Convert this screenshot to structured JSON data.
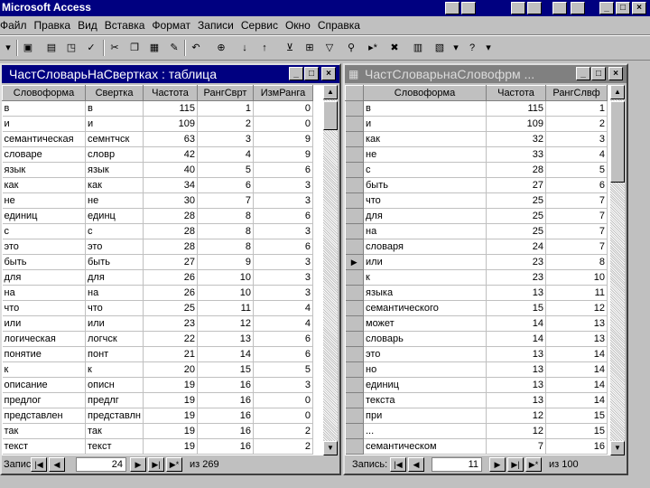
{
  "app": {
    "title": "Microsoft Access"
  },
  "menu": [
    "Файл",
    "Правка",
    "Вид",
    "Вставка",
    "Формат",
    "Записи",
    "Сервис",
    "Окно",
    "Справка"
  ],
  "left": {
    "title": "ЧастСловарьНаСвертках : таблица",
    "columns": [
      "Словоформа",
      "Свертка",
      "Частота",
      "РангСврт",
      "ИзмРанга"
    ],
    "rows": [
      [
        "в",
        "в",
        "115",
        "1",
        "0"
      ],
      [
        "и",
        "и",
        "109",
        "2",
        "0"
      ],
      [
        "семантическая",
        "семнтчск",
        "63",
        "3",
        "9"
      ],
      [
        "словаре",
        "словр",
        "42",
        "4",
        "9"
      ],
      [
        "язык",
        "язык",
        "40",
        "5",
        "6"
      ],
      [
        "как",
        "как",
        "34",
        "6",
        "3"
      ],
      [
        "не",
        "не",
        "30",
        "7",
        "3"
      ],
      [
        "единиц",
        "единц",
        "28",
        "8",
        "6"
      ],
      [
        "с",
        "с",
        "28",
        "8",
        "3"
      ],
      [
        "это",
        "это",
        "28",
        "8",
        "6"
      ],
      [
        "быть",
        "быть",
        "27",
        "9",
        "3"
      ],
      [
        "для",
        "для",
        "26",
        "10",
        "3"
      ],
      [
        "на",
        "на",
        "26",
        "10",
        "3"
      ],
      [
        "что",
        "что",
        "25",
        "11",
        "4"
      ],
      [
        "или",
        "или",
        "23",
        "12",
        "4"
      ],
      [
        "логическая",
        "логчск",
        "22",
        "13",
        "6"
      ],
      [
        "понятие",
        "понт",
        "21",
        "14",
        "6"
      ],
      [
        "к",
        "к",
        "20",
        "15",
        "5"
      ],
      [
        "описание",
        "описн",
        "19",
        "16",
        "3"
      ],
      [
        "предлог",
        "предлг",
        "19",
        "16",
        "0"
      ],
      [
        "представлен",
        "представлн",
        "19",
        "16",
        "0"
      ],
      [
        "так",
        "так",
        "19",
        "16",
        "2"
      ],
      [
        "текст",
        "текст",
        "19",
        "16",
        "2"
      ]
    ],
    "nav": {
      "label": "Запись:",
      "current": "24",
      "total": "из 269"
    }
  },
  "right": {
    "title": "ЧастСловарьнаСловофрм ...",
    "columns": [
      "Словоформа",
      "Частота",
      "РангСлвф"
    ],
    "rows": [
      [
        "в",
        "115",
        "1"
      ],
      [
        "и",
        "109",
        "2"
      ],
      [
        "как",
        "32",
        "3"
      ],
      [
        "не",
        "33",
        "4"
      ],
      [
        "с",
        "28",
        "5"
      ],
      [
        "быть",
        "27",
        "6"
      ],
      [
        "что",
        "25",
        "7"
      ],
      [
        "для",
        "25",
        "7"
      ],
      [
        "на",
        "25",
        "7"
      ],
      [
        "словаря",
        "24",
        "7"
      ],
      [
        "или",
        "23",
        "8"
      ],
      [
        "к",
        "23",
        "10"
      ],
      [
        "языка",
        "13",
        "11"
      ],
      [
        "семантического",
        "15",
        "12"
      ],
      [
        "может",
        "14",
        "13"
      ],
      [
        "словарь",
        "14",
        "13"
      ],
      [
        "это",
        "13",
        "14"
      ],
      [
        "но",
        "13",
        "14"
      ],
      [
        "единиц",
        "13",
        "14"
      ],
      [
        "текста",
        "13",
        "14"
      ],
      [
        "при",
        "12",
        "15"
      ],
      [
        "...",
        "12",
        "15"
      ],
      [
        "семантическом",
        "7",
        "16"
      ]
    ],
    "current_row": 10,
    "nav": {
      "label": "Запись:",
      "current": "11",
      "total": "из 100"
    }
  },
  "icons": {
    "selector": "▶",
    "first": "|◀",
    "prev": "◀",
    "next": "▶",
    "last": "▶|",
    "new": "▶*",
    "up": "▲",
    "down": "▼",
    "min": "_",
    "max": "□",
    "close": "×"
  }
}
